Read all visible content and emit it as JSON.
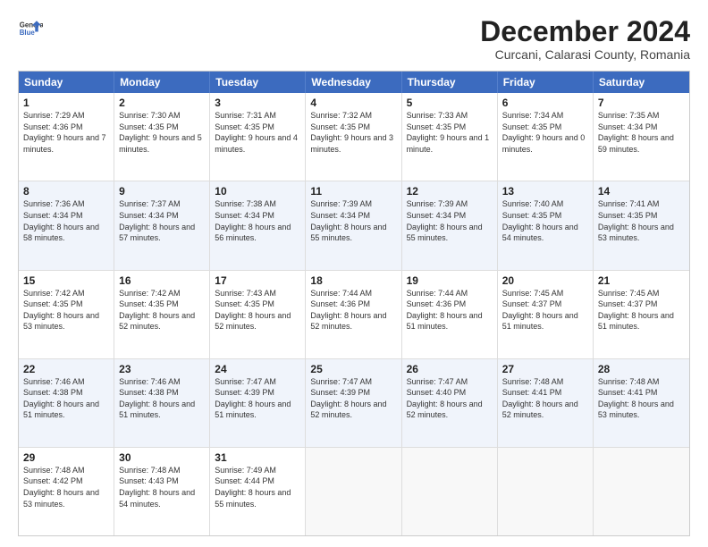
{
  "logo": {
    "line1": "General",
    "line2": "Blue"
  },
  "title": "December 2024",
  "subtitle": "Curcani, Calarasi County, Romania",
  "header_days": [
    "Sunday",
    "Monday",
    "Tuesday",
    "Wednesday",
    "Thursday",
    "Friday",
    "Saturday"
  ],
  "weeks": [
    [
      {
        "day": "1",
        "sunrise": "Sunrise: 7:29 AM",
        "sunset": "Sunset: 4:36 PM",
        "daylight": "Daylight: 9 hours and 7 minutes."
      },
      {
        "day": "2",
        "sunrise": "Sunrise: 7:30 AM",
        "sunset": "Sunset: 4:35 PM",
        "daylight": "Daylight: 9 hours and 5 minutes."
      },
      {
        "day": "3",
        "sunrise": "Sunrise: 7:31 AM",
        "sunset": "Sunset: 4:35 PM",
        "daylight": "Daylight: 9 hours and 4 minutes."
      },
      {
        "day": "4",
        "sunrise": "Sunrise: 7:32 AM",
        "sunset": "Sunset: 4:35 PM",
        "daylight": "Daylight: 9 hours and 3 minutes."
      },
      {
        "day": "5",
        "sunrise": "Sunrise: 7:33 AM",
        "sunset": "Sunset: 4:35 PM",
        "daylight": "Daylight: 9 hours and 1 minute."
      },
      {
        "day": "6",
        "sunrise": "Sunrise: 7:34 AM",
        "sunset": "Sunset: 4:35 PM",
        "daylight": "Daylight: 9 hours and 0 minutes."
      },
      {
        "day": "7",
        "sunrise": "Sunrise: 7:35 AM",
        "sunset": "Sunset: 4:34 PM",
        "daylight": "Daylight: 8 hours and 59 minutes."
      }
    ],
    [
      {
        "day": "8",
        "sunrise": "Sunrise: 7:36 AM",
        "sunset": "Sunset: 4:34 PM",
        "daylight": "Daylight: 8 hours and 58 minutes."
      },
      {
        "day": "9",
        "sunrise": "Sunrise: 7:37 AM",
        "sunset": "Sunset: 4:34 PM",
        "daylight": "Daylight: 8 hours and 57 minutes."
      },
      {
        "day": "10",
        "sunrise": "Sunrise: 7:38 AM",
        "sunset": "Sunset: 4:34 PM",
        "daylight": "Daylight: 8 hours and 56 minutes."
      },
      {
        "day": "11",
        "sunrise": "Sunrise: 7:39 AM",
        "sunset": "Sunset: 4:34 PM",
        "daylight": "Daylight: 8 hours and 55 minutes."
      },
      {
        "day": "12",
        "sunrise": "Sunrise: 7:39 AM",
        "sunset": "Sunset: 4:34 PM",
        "daylight": "Daylight: 8 hours and 55 minutes."
      },
      {
        "day": "13",
        "sunrise": "Sunrise: 7:40 AM",
        "sunset": "Sunset: 4:35 PM",
        "daylight": "Daylight: 8 hours and 54 minutes."
      },
      {
        "day": "14",
        "sunrise": "Sunrise: 7:41 AM",
        "sunset": "Sunset: 4:35 PM",
        "daylight": "Daylight: 8 hours and 53 minutes."
      }
    ],
    [
      {
        "day": "15",
        "sunrise": "Sunrise: 7:42 AM",
        "sunset": "Sunset: 4:35 PM",
        "daylight": "Daylight: 8 hours and 53 minutes."
      },
      {
        "day": "16",
        "sunrise": "Sunrise: 7:42 AM",
        "sunset": "Sunset: 4:35 PM",
        "daylight": "Daylight: 8 hours and 52 minutes."
      },
      {
        "day": "17",
        "sunrise": "Sunrise: 7:43 AM",
        "sunset": "Sunset: 4:35 PM",
        "daylight": "Daylight: 8 hours and 52 minutes."
      },
      {
        "day": "18",
        "sunrise": "Sunrise: 7:44 AM",
        "sunset": "Sunset: 4:36 PM",
        "daylight": "Daylight: 8 hours and 52 minutes."
      },
      {
        "day": "19",
        "sunrise": "Sunrise: 7:44 AM",
        "sunset": "Sunset: 4:36 PM",
        "daylight": "Daylight: 8 hours and 51 minutes."
      },
      {
        "day": "20",
        "sunrise": "Sunrise: 7:45 AM",
        "sunset": "Sunset: 4:37 PM",
        "daylight": "Daylight: 8 hours and 51 minutes."
      },
      {
        "day": "21",
        "sunrise": "Sunrise: 7:45 AM",
        "sunset": "Sunset: 4:37 PM",
        "daylight": "Daylight: 8 hours and 51 minutes."
      }
    ],
    [
      {
        "day": "22",
        "sunrise": "Sunrise: 7:46 AM",
        "sunset": "Sunset: 4:38 PM",
        "daylight": "Daylight: 8 hours and 51 minutes."
      },
      {
        "day": "23",
        "sunrise": "Sunrise: 7:46 AM",
        "sunset": "Sunset: 4:38 PM",
        "daylight": "Daylight: 8 hours and 51 minutes."
      },
      {
        "day": "24",
        "sunrise": "Sunrise: 7:47 AM",
        "sunset": "Sunset: 4:39 PM",
        "daylight": "Daylight: 8 hours and 51 minutes."
      },
      {
        "day": "25",
        "sunrise": "Sunrise: 7:47 AM",
        "sunset": "Sunset: 4:39 PM",
        "daylight": "Daylight: 8 hours and 52 minutes."
      },
      {
        "day": "26",
        "sunrise": "Sunrise: 7:47 AM",
        "sunset": "Sunset: 4:40 PM",
        "daylight": "Daylight: 8 hours and 52 minutes."
      },
      {
        "day": "27",
        "sunrise": "Sunrise: 7:48 AM",
        "sunset": "Sunset: 4:41 PM",
        "daylight": "Daylight: 8 hours and 52 minutes."
      },
      {
        "day": "28",
        "sunrise": "Sunrise: 7:48 AM",
        "sunset": "Sunset: 4:41 PM",
        "daylight": "Daylight: 8 hours and 53 minutes."
      }
    ],
    [
      {
        "day": "29",
        "sunrise": "Sunrise: 7:48 AM",
        "sunset": "Sunset: 4:42 PM",
        "daylight": "Daylight: 8 hours and 53 minutes."
      },
      {
        "day": "30",
        "sunrise": "Sunrise: 7:48 AM",
        "sunset": "Sunset: 4:43 PM",
        "daylight": "Daylight: 8 hours and 54 minutes."
      },
      {
        "day": "31",
        "sunrise": "Sunrise: 7:49 AM",
        "sunset": "Sunset: 4:44 PM",
        "daylight": "Daylight: 8 hours and 55 minutes."
      },
      {
        "day": "",
        "sunrise": "",
        "sunset": "",
        "daylight": ""
      },
      {
        "day": "",
        "sunrise": "",
        "sunset": "",
        "daylight": ""
      },
      {
        "day": "",
        "sunrise": "",
        "sunset": "",
        "daylight": ""
      },
      {
        "day": "",
        "sunrise": "",
        "sunset": "",
        "daylight": ""
      }
    ]
  ]
}
